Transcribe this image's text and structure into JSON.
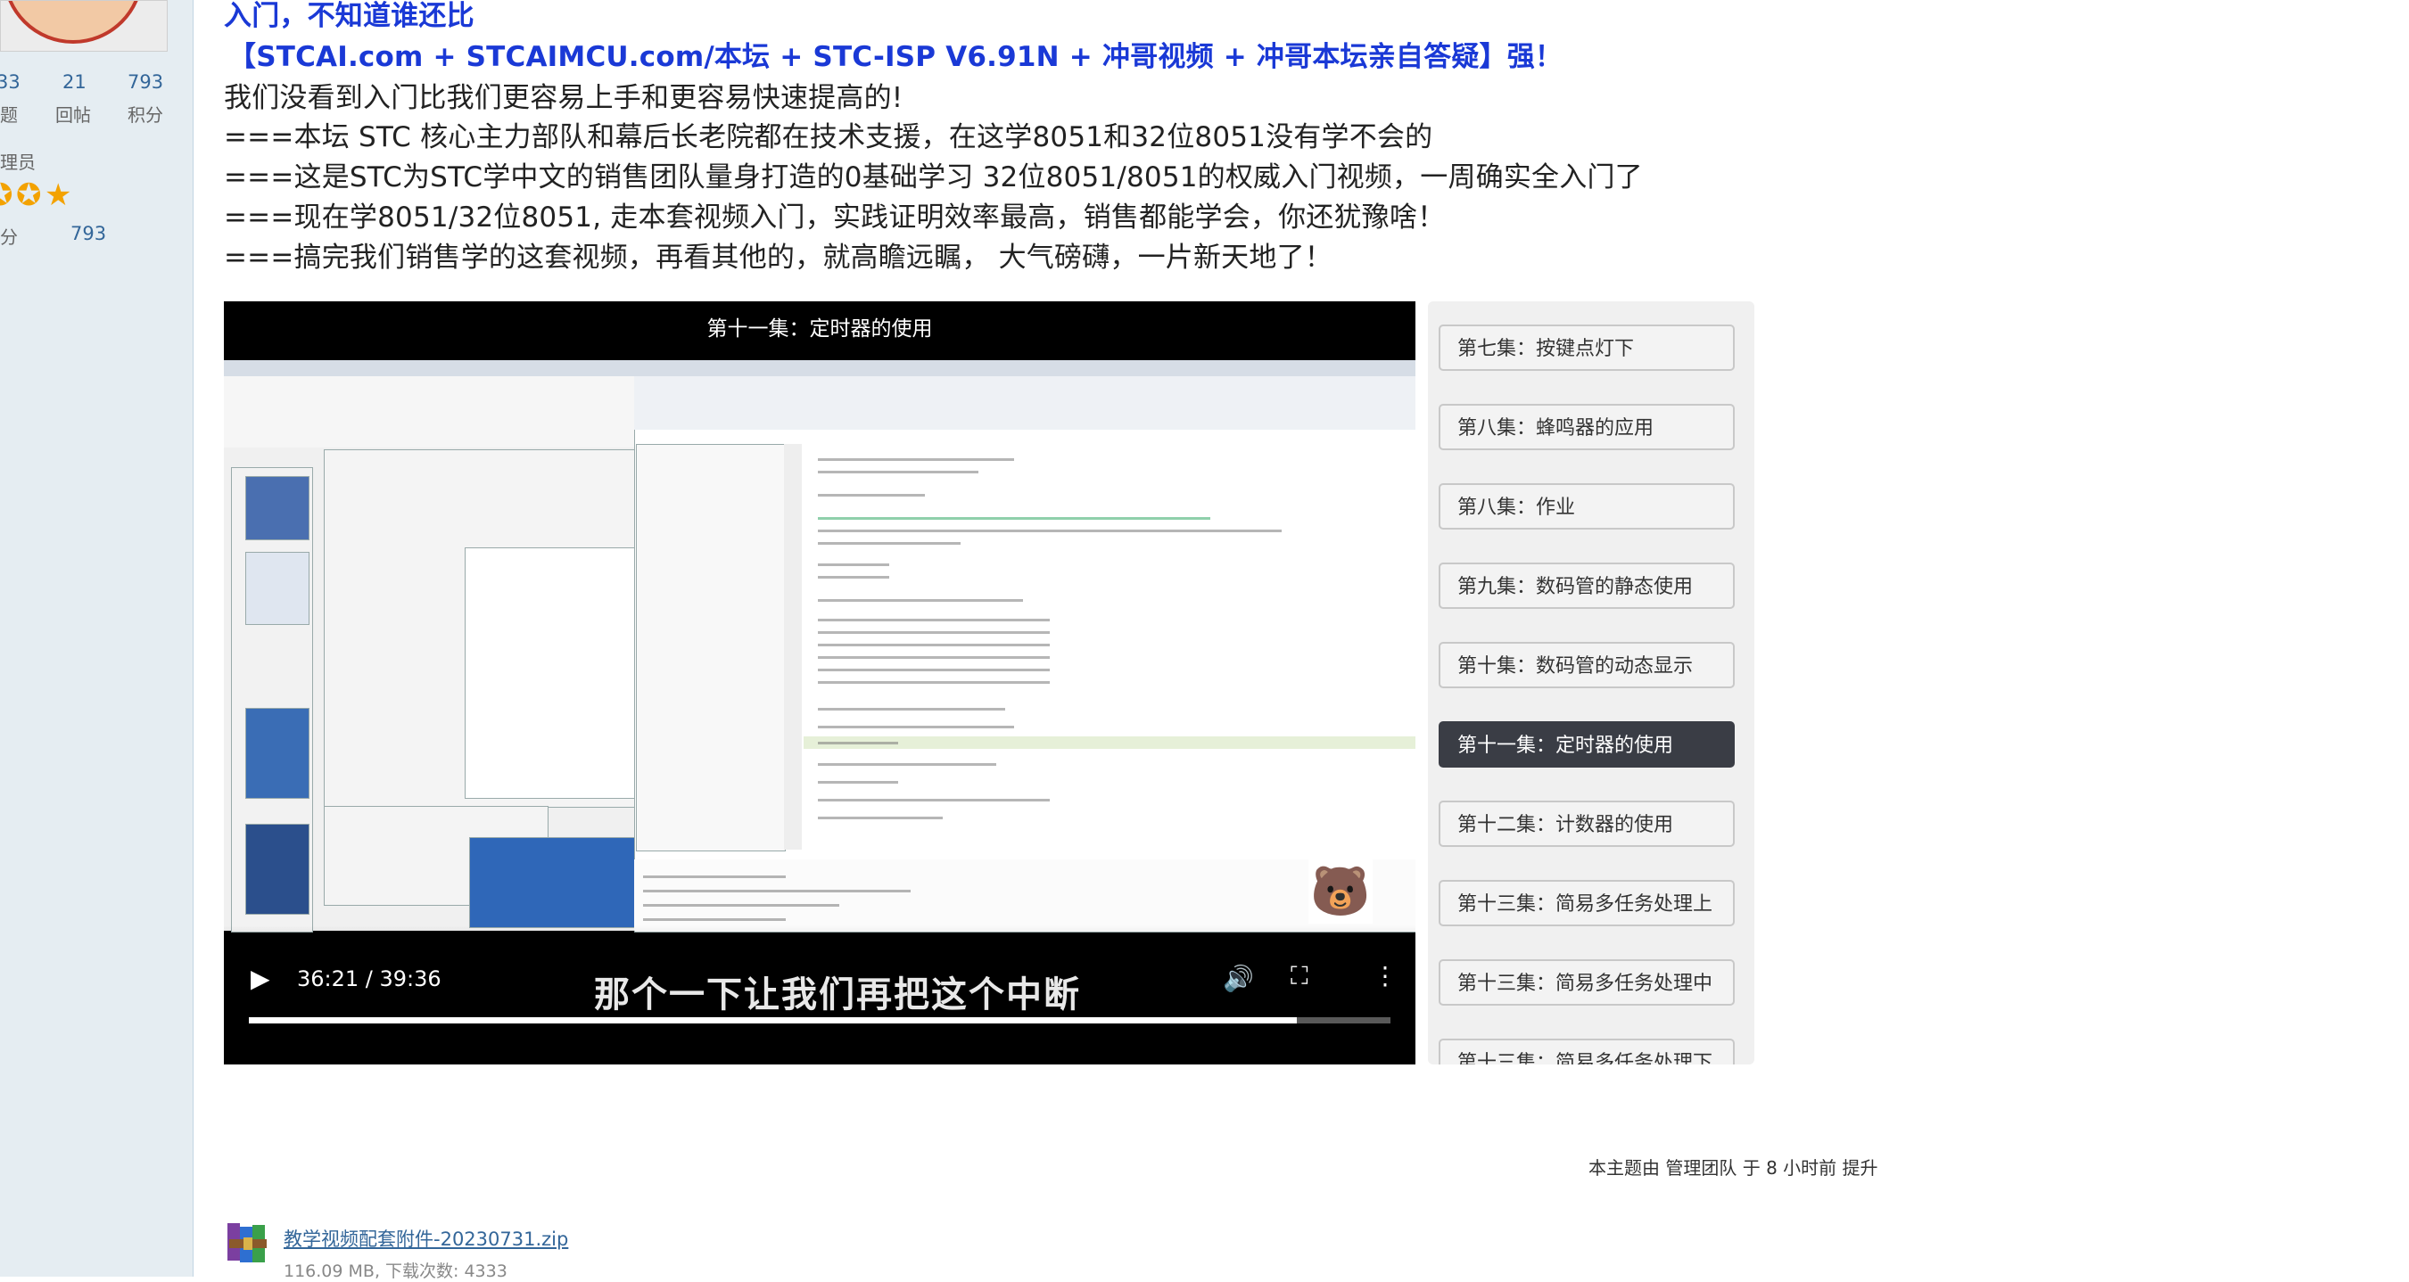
{
  "sidebar": {
    "stats": [
      {
        "value": "33",
        "label": "主题"
      },
      {
        "value": "21",
        "label": "回帖"
      },
      {
        "value": "793",
        "label": "积分"
      }
    ],
    "role": "管理员",
    "points_label": "积分",
    "points_value": "793"
  },
  "post": {
    "lines": [
      {
        "text": "入门，不知道谁还比",
        "style": "blue"
      },
      {
        "text": "【STCAI.com + STCAIMCU.com/本坛 + STC-ISP V6.91N + 冲哥视频 + 冲哥本坛亲自答疑】强！",
        "style": "blue"
      },
      {
        "text": "我们没看到入门比我们更容易上手和更容易快速提高的!",
        "style": "normal"
      },
      {
        "text": "===本坛 STC  核心主力部队和幕后长老院都在技术支援，在这学8051和32位8051没有学不会的",
        "style": "normal"
      },
      {
        "text": "===这是STC为STC学中文的销售团队量身打造的0基础学习 32位8051/8051的权威入门视频，一周确实全入门了",
        "style": "normal"
      },
      {
        "text": "===现在学8051/32位8051, 走本套视频入门，实践证明效率最高，销售都能学会，你还犹豫啥！",
        "style": "normal"
      },
      {
        "text": "===搞完我们销售学的这套视频，再看其他的，就高瞻远瞩， 大气磅礴，一片新天地了！",
        "style": "normal"
      }
    ]
  },
  "video": {
    "title": "第十一集：定时器的使用",
    "time": "36:21 / 39:36",
    "subtitle": "那个一下让我们再把这个中断",
    "progress": 0.918
  },
  "playlist": {
    "items": [
      {
        "label": "第七集：按键点灯下",
        "active": false
      },
      {
        "label": "第八集：蜂鸣器的应用",
        "active": false
      },
      {
        "label": "第八集：作业",
        "active": false
      },
      {
        "label": "第九集：数码管的静态使用",
        "active": false
      },
      {
        "label": "第十集：数码管的动态显示",
        "active": false
      },
      {
        "label": "第十一集：定时器的使用",
        "active": true
      },
      {
        "label": "第十二集：计数器的使用",
        "active": false
      },
      {
        "label": "第十三集：简易多任务处理上",
        "active": false
      },
      {
        "label": "第十三集：简易多任务处理中",
        "active": false
      },
      {
        "label": "第十三集：简易多任务处理下",
        "active": false
      }
    ]
  },
  "thread_note": "本主题由 管理团队 于 8 小时前 提升",
  "attachment": {
    "filename": "教学视频配套附件-20230731.zip",
    "meta": "116.09 MB, 下载次数: 4333"
  },
  "colors": {
    "accent_blue": "#1a39d6",
    "link": "#336699",
    "sidebar_bg": "#e5edf2",
    "active_episode": "#3a3d45"
  },
  "icons": [
    "play-icon",
    "volume-icon",
    "fullscreen-icon",
    "more-icon",
    "star-icon",
    "archive-icon"
  ]
}
